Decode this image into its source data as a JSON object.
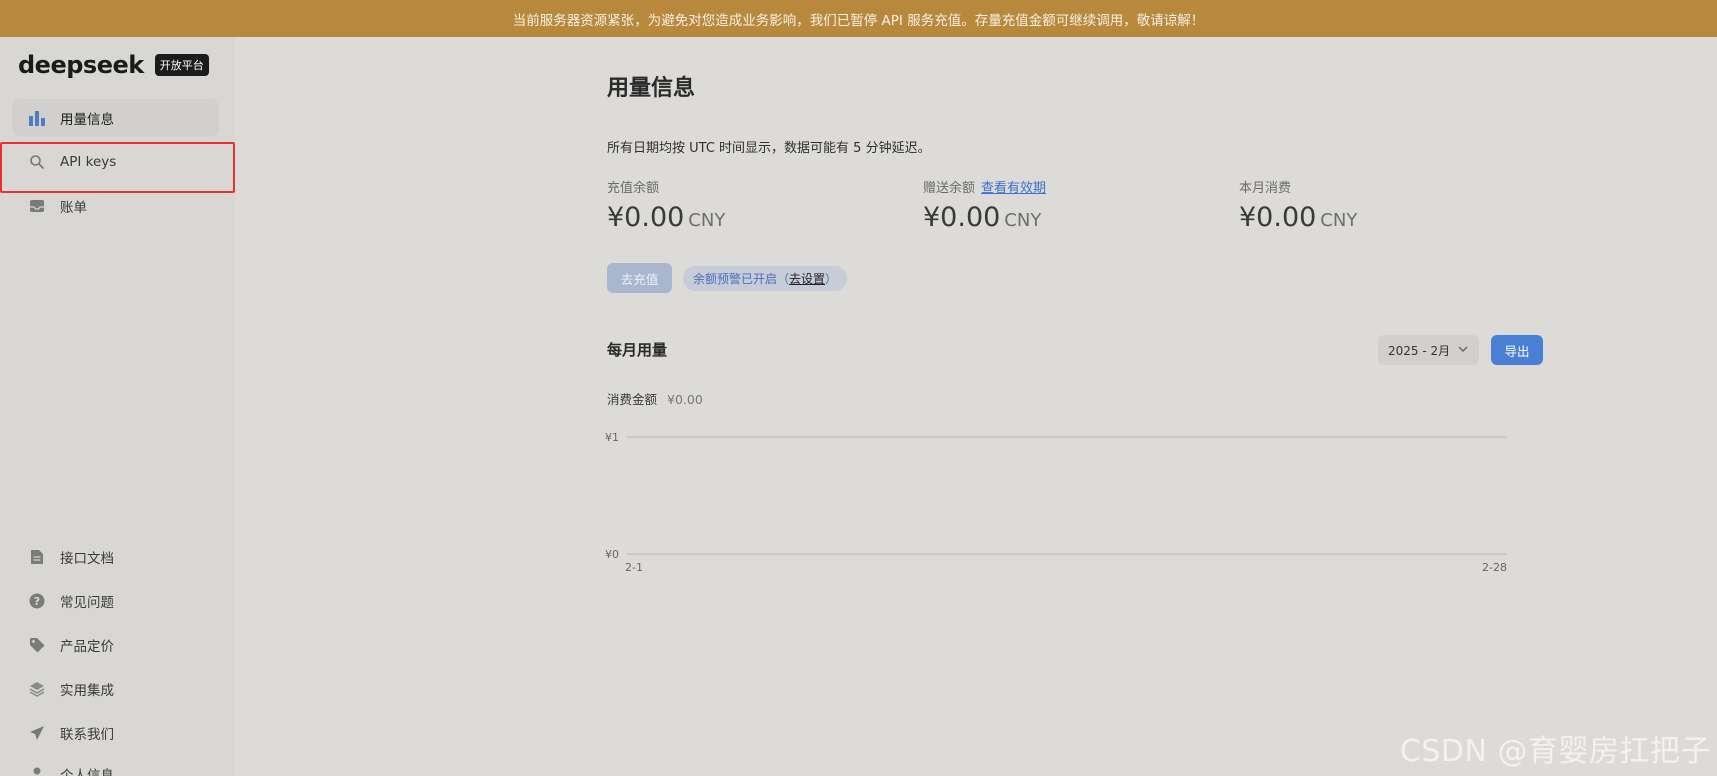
{
  "banner": {
    "text": "当前服务器资源紧张，为避免对您造成业务影响，我们已暂停 API 服务充值。存量充值金额可继续调用，敬请谅解！"
  },
  "brand": {
    "logo_text": "deepseek",
    "badge": "开放平台"
  },
  "sidebar": {
    "top_items": [
      {
        "label": "用量信息",
        "icon": "bar-chart-icon",
        "active": true
      },
      {
        "label": "API keys",
        "icon": "search-key-icon",
        "active": false
      },
      {
        "label": "账单",
        "icon": "inbox-icon",
        "active": false
      }
    ],
    "bottom_items": [
      {
        "label": "接口文档",
        "icon": "document-icon"
      },
      {
        "label": "常见问题",
        "icon": "question-icon"
      },
      {
        "label": "产品定价",
        "icon": "tag-icon"
      },
      {
        "label": "实用集成",
        "icon": "layers-icon"
      },
      {
        "label": "联系我们",
        "icon": "send-icon"
      },
      {
        "label": "个人信息",
        "icon": "user-icon"
      }
    ]
  },
  "main": {
    "title": "用量信息",
    "note": "所有日期均按 UTC 时间显示，数据可能有 5 分钟延迟。",
    "stats": [
      {
        "label": "充值余额",
        "value": "¥0.00",
        "unit": "CNY"
      },
      {
        "label": "赠送余额",
        "link": "查看有效期",
        "value": "¥0.00",
        "unit": "CNY"
      },
      {
        "label": "本月消费",
        "value": "¥0.00",
        "unit": "CNY"
      }
    ],
    "recharge_button": "去充值",
    "alert": {
      "text": "余额预警已开启",
      "open_paren": "（",
      "link": "去设置",
      "close_paren": "）"
    },
    "monthly": {
      "title": "每月用量",
      "month_value": "2025 - 2月",
      "export_button": "导出",
      "spend_label": "消费金额",
      "spend_value": "¥0.00"
    }
  },
  "chart_data": {
    "type": "line",
    "x": [
      "2-1",
      "2-28"
    ],
    "series": [],
    "yticks": [
      "¥1",
      "¥0"
    ],
    "ylim": [
      0,
      1
    ],
    "grid": true
  },
  "watermark": "CSDN @育婴房扛把子",
  "colors": {
    "banner": "#b8893c",
    "accent": "#4a7fd6",
    "highlight": "#e8322e"
  }
}
